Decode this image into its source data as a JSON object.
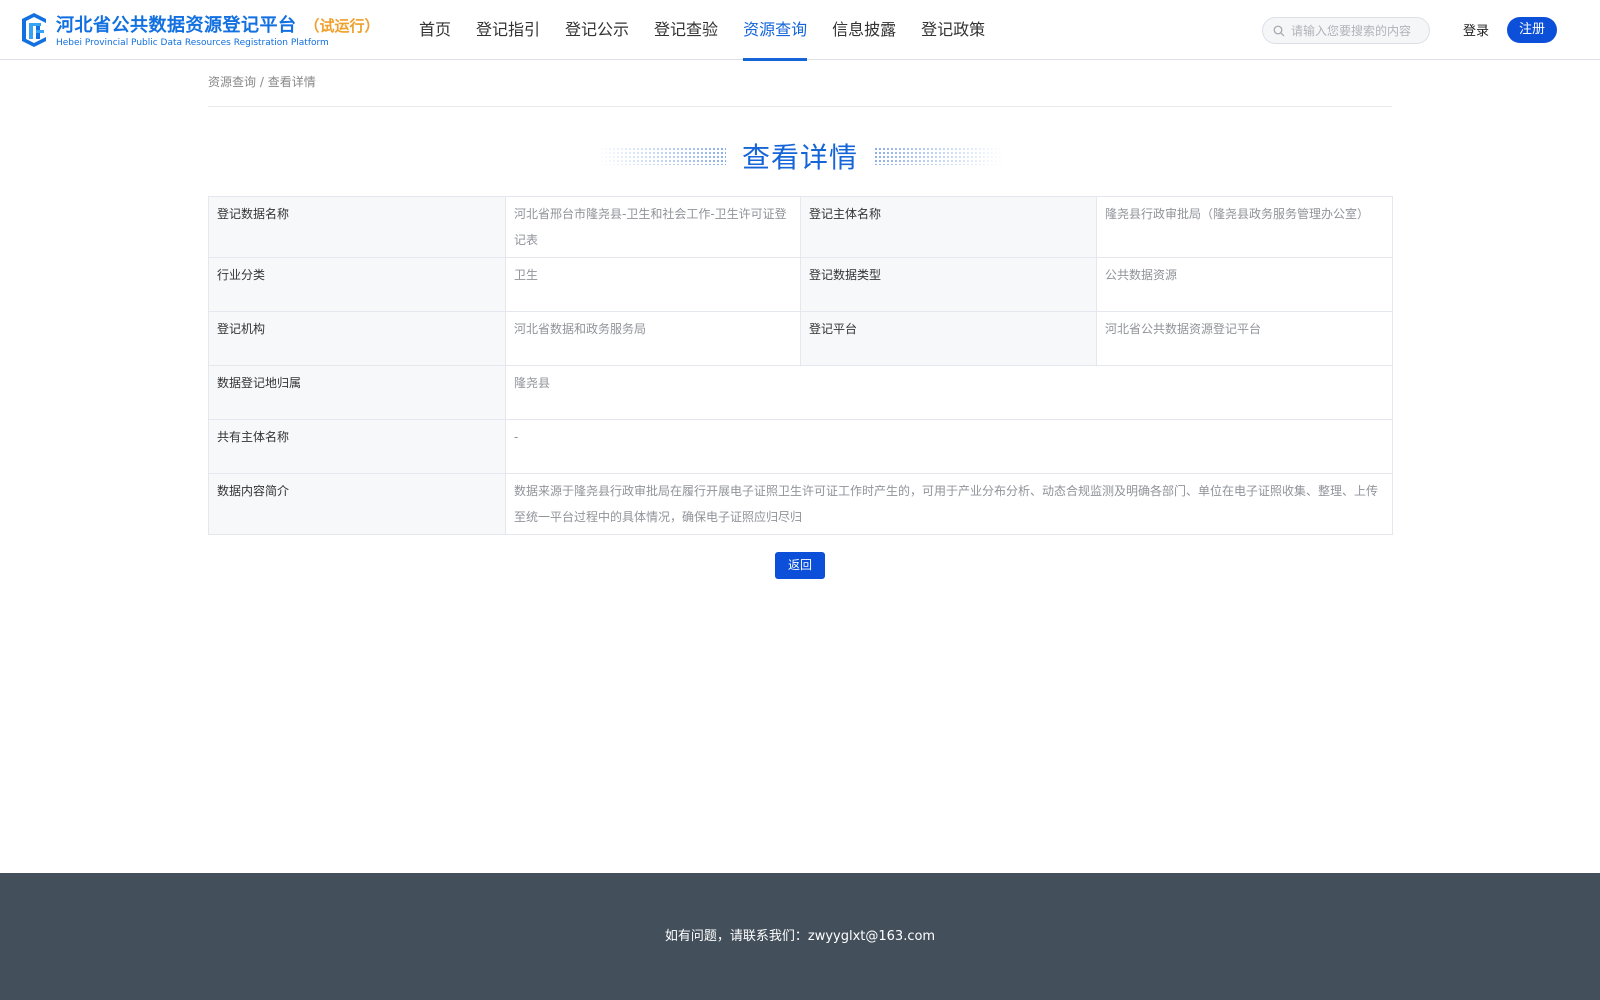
{
  "header": {
    "logo_cn": "河北省公共数据资源登记平台",
    "logo_trial": "（试运行）",
    "logo_en": "Hebei Provincial Public Data Resources Registration Platform",
    "nav": [
      {
        "label": "首页"
      },
      {
        "label": "登记指引"
      },
      {
        "label": "登记公示"
      },
      {
        "label": "登记查验"
      },
      {
        "label": "资源查询",
        "active": true
      },
      {
        "label": "信息披露"
      },
      {
        "label": "登记政策"
      }
    ],
    "search_placeholder": "请输入您要搜索的内容",
    "login_label": "登录",
    "register_label": "注册",
    "colors": {
      "brand": "#1565d8",
      "button": "#0c4fd8",
      "trial": "#f0a02c"
    }
  },
  "breadcrumb": {
    "parent": "资源查询",
    "separator": " / ",
    "current": "查看详情"
  },
  "detail": {
    "title": "查看详情",
    "rows": [
      {
        "label1": "登记数据名称",
        "value1": "河北省邢台市隆尧县-卫生和社会工作-卫生许可证登记表",
        "label2": "登记主体名称",
        "value2": "隆尧县行政审批局（隆尧县政务服务管理办公室）"
      },
      {
        "label1": "行业分类",
        "value1": "卫生",
        "label2": "登记数据类型",
        "value2": "公共数据资源"
      },
      {
        "label1": "登记机构",
        "value1": "河北省数据和政务服务局",
        "label2": "登记平台",
        "value2": "河北省公共数据资源登记平台"
      }
    ],
    "wide_rows": [
      {
        "label": "数据登记地归属",
        "value": "隆尧县"
      },
      {
        "label": "共有主体名称",
        "value": "-"
      },
      {
        "label": "数据内容简介",
        "value": "数据来源于隆尧县行政审批局在履行开展电子证照卫生许可证工作时产生的，可用于产业分布分析、动态合规监测及明确各部门、单位在电子证照收集、整理、上传至统一平台过程中的具体情况，确保电子证照应归尽归"
      }
    ],
    "back_label": "返回"
  },
  "footer": {
    "contact": "如有问题，请联系我们：zwyyglxt@163.com",
    "background": "#434f5b"
  }
}
